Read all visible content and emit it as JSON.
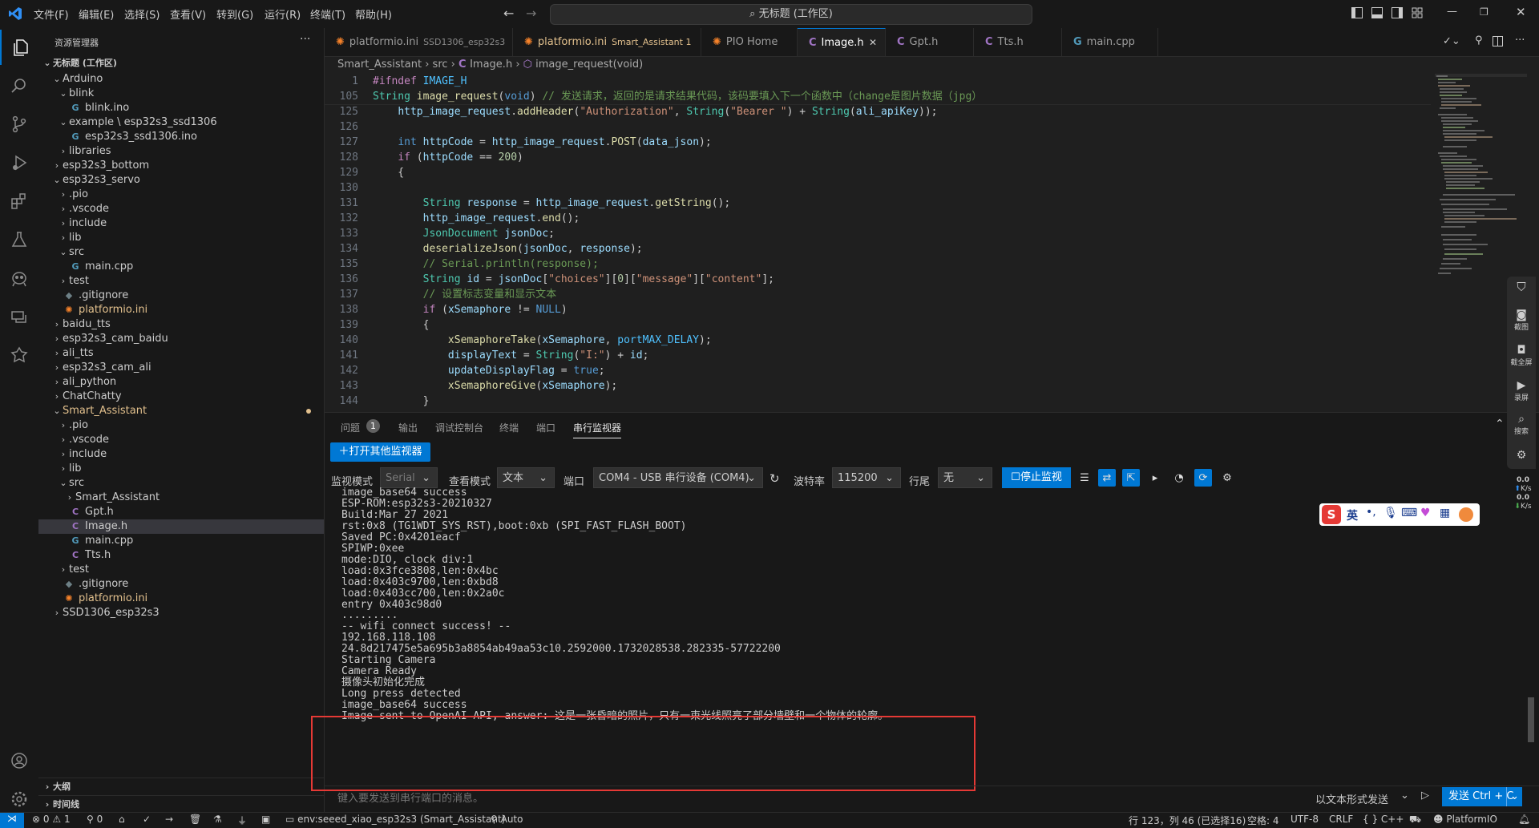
{
  "menu": [
    "文件(F)",
    "编辑(E)",
    "选择(S)",
    "查看(V)",
    "转到(G)",
    "运行(R)",
    "终端(T)",
    "帮助(H)"
  ],
  "command_center": "无标题 (工作区)",
  "sidebar": {
    "title": "资源管理器",
    "workspace": "无标题 (工作区)",
    "tree": [
      {
        "label": "Arduino",
        "depth": 1,
        "kind": "folder-open"
      },
      {
        "label": "blink",
        "depth": 2,
        "kind": "folder-open"
      },
      {
        "label": "blink.ino",
        "depth": 3,
        "kind": "ino"
      },
      {
        "label": "example \\ esp32s3_ssd1306",
        "depth": 2,
        "kind": "folder-open"
      },
      {
        "label": "esp32s3_ssd1306.ino",
        "depth": 3,
        "kind": "ino"
      },
      {
        "label": "libraries",
        "depth": 2,
        "kind": "folder"
      },
      {
        "label": "esp32s3_bottom",
        "depth": 1,
        "kind": "folder"
      },
      {
        "label": "esp32s3_servo",
        "depth": 1,
        "kind": "folder-open"
      },
      {
        "label": ".pio",
        "depth": 2,
        "kind": "folder"
      },
      {
        "label": ".vscode",
        "depth": 2,
        "kind": "folder"
      },
      {
        "label": "include",
        "depth": 2,
        "kind": "folder"
      },
      {
        "label": "lib",
        "depth": 2,
        "kind": "folder"
      },
      {
        "label": "src",
        "depth": 2,
        "kind": "folder-open"
      },
      {
        "label": "main.cpp",
        "depth": 3,
        "kind": "cpp"
      },
      {
        "label": "test",
        "depth": 2,
        "kind": "folder"
      },
      {
        "label": ".gitignore",
        "depth": 2,
        "kind": "git"
      },
      {
        "label": "platformio.ini",
        "depth": 2,
        "kind": "pio"
      },
      {
        "label": "baidu_tts",
        "depth": 1,
        "kind": "folder"
      },
      {
        "label": "esp32s3_cam_baidu",
        "depth": 1,
        "kind": "folder"
      },
      {
        "label": "ali_tts",
        "depth": 1,
        "kind": "folder"
      },
      {
        "label": "esp32s3_cam_ali",
        "depth": 1,
        "kind": "folder"
      },
      {
        "label": "ali_python",
        "depth": 1,
        "kind": "folder"
      },
      {
        "label": "ChatChatty",
        "depth": 1,
        "kind": "folder"
      },
      {
        "label": "Smart_Assistant",
        "depth": 1,
        "kind": "folder-open",
        "modified": true
      },
      {
        "label": ".pio",
        "depth": 2,
        "kind": "folder"
      },
      {
        "label": ".vscode",
        "depth": 2,
        "kind": "folder"
      },
      {
        "label": "include",
        "depth": 2,
        "kind": "folder"
      },
      {
        "label": "lib",
        "depth": 2,
        "kind": "folder"
      },
      {
        "label": "src",
        "depth": 2,
        "kind": "folder-open"
      },
      {
        "label": "Smart_Assistant",
        "depth": 3,
        "kind": "folder"
      },
      {
        "label": "Gpt.h",
        "depth": 3,
        "kind": "h"
      },
      {
        "label": "Image.h",
        "depth": 3,
        "kind": "h",
        "selected": true
      },
      {
        "label": "main.cpp",
        "depth": 3,
        "kind": "cpp"
      },
      {
        "label": "Tts.h",
        "depth": 3,
        "kind": "h"
      },
      {
        "label": "test",
        "depth": 2,
        "kind": "folder"
      },
      {
        "label": ".gitignore",
        "depth": 2,
        "kind": "git"
      },
      {
        "label": "platformio.ini",
        "depth": 2,
        "kind": "pio",
        "modified": true
      },
      {
        "label": "SSD1306_esp32s3",
        "depth": 1,
        "kind": "folder"
      }
    ],
    "outline": "大纲",
    "timeline": "时间线"
  },
  "tabs": [
    {
      "label": "platformio.ini",
      "sub": "SSD1306_esp32s3",
      "icon": "pio"
    },
    {
      "label": "platformio.ini",
      "sub": "Smart_Assistant 1",
      "icon": "pio",
      "modified": true
    },
    {
      "label": "PIO Home",
      "sub": "",
      "icon": "pio"
    },
    {
      "label": "Image.h",
      "sub": "",
      "icon": "h",
      "active": true
    },
    {
      "label": "Gpt.h",
      "sub": "",
      "icon": "h"
    },
    {
      "label": "Tts.h",
      "sub": "",
      "icon": "h"
    },
    {
      "label": "main.cpp",
      "sub": "",
      "icon": "cpp"
    }
  ],
  "breadcrumb": [
    "Smart_Assistant",
    "src",
    "Image.h",
    "image_request(void)"
  ],
  "code": [
    {
      "n": "1",
      "t": [
        [
          "pp",
          "#ifndef "
        ],
        [
          "cn",
          "IMAGE_H"
        ]
      ]
    },
    {
      "n": "105",
      "t": [
        [
          "ty",
          "String "
        ],
        [
          "fn",
          "image_request"
        ],
        [
          "",
          "("
        ],
        [
          "kw",
          "void"
        ],
        [
          "",
          ") "
        ],
        [
          "cm",
          "// 发送请求，返回的是请求结果代码，该码要填入下一个函数中（change是图片数据（jpg）"
        ]
      ]
    },
    {
      "n": "125",
      "t": [
        [
          "",
          "    "
        ],
        [
          "vr",
          "http_image_request"
        ],
        [
          "",
          "."
        ],
        [
          "fn",
          "addHeader"
        ],
        [
          "",
          "("
        ],
        [
          "st",
          "\"Authorization\""
        ],
        [
          "",
          ", "
        ],
        [
          "ty",
          "String"
        ],
        [
          "",
          "("
        ],
        [
          "st",
          "\"Bearer \""
        ],
        [
          "",
          ") + "
        ],
        [
          "ty",
          "String"
        ],
        [
          "",
          "("
        ],
        [
          "vr",
          "ali_apiKey"
        ],
        [
          "",
          "));"
        ]
      ]
    },
    {
      "n": "126",
      "t": []
    },
    {
      "n": "127",
      "t": [
        [
          "",
          "    "
        ],
        [
          "kw",
          "int "
        ],
        [
          "vr",
          "httpCode"
        ],
        [
          "",
          " = "
        ],
        [
          "vr",
          "http_image_request"
        ],
        [
          "",
          "."
        ],
        [
          "fn",
          "POST"
        ],
        [
          "",
          "("
        ],
        [
          "vr",
          "data_json"
        ],
        [
          "",
          ");"
        ]
      ]
    },
    {
      "n": "128",
      "t": [
        [
          "",
          "    "
        ],
        [
          "pp",
          "if "
        ],
        [
          "",
          "("
        ],
        [
          "vr",
          "httpCode"
        ],
        [
          "",
          " == "
        ],
        [
          "nm",
          "200"
        ],
        [
          "",
          ")"
        ]
      ]
    },
    {
      "n": "129",
      "t": [
        [
          "",
          "    {"
        ]
      ]
    },
    {
      "n": "130",
      "t": []
    },
    {
      "n": "131",
      "t": [
        [
          "",
          "        "
        ],
        [
          "ty",
          "String "
        ],
        [
          "vr",
          "response"
        ],
        [
          "",
          " = "
        ],
        [
          "vr",
          "http_image_request"
        ],
        [
          "",
          "."
        ],
        [
          "fn",
          "getString"
        ],
        [
          "",
          "();"
        ]
      ]
    },
    {
      "n": "132",
      "t": [
        [
          "",
          "        "
        ],
        [
          "vr",
          "http_image_request"
        ],
        [
          "",
          "."
        ],
        [
          "fn",
          "end"
        ],
        [
          "",
          "();"
        ]
      ]
    },
    {
      "n": "133",
      "t": [
        [
          "",
          "        "
        ],
        [
          "ty",
          "JsonDocument "
        ],
        [
          "vr",
          "jsonDoc"
        ],
        [
          "",
          ";"
        ]
      ]
    },
    {
      "n": "134",
      "t": [
        [
          "",
          "        "
        ],
        [
          "fn",
          "deserializeJson"
        ],
        [
          "",
          "("
        ],
        [
          "vr",
          "jsonDoc"
        ],
        [
          "",
          ", "
        ],
        [
          "vr",
          "response"
        ],
        [
          "",
          ");"
        ]
      ]
    },
    {
      "n": "135",
      "t": [
        [
          "",
          "        "
        ],
        [
          "cm",
          "// Serial.println(response);"
        ]
      ]
    },
    {
      "n": "136",
      "t": [
        [
          "",
          "        "
        ],
        [
          "ty",
          "String "
        ],
        [
          "vr",
          "id"
        ],
        [
          "",
          " = "
        ],
        [
          "vr",
          "jsonDoc"
        ],
        [
          "",
          "["
        ],
        [
          "st",
          "\"choices\""
        ],
        [
          "",
          "]["
        ],
        [
          "nm",
          "0"
        ],
        [
          "",
          "]["
        ],
        [
          "st",
          "\"message\""
        ],
        [
          "",
          "]["
        ],
        [
          "st",
          "\"content\""
        ],
        [
          "",
          "];"
        ]
      ]
    },
    {
      "n": "137",
      "t": [
        [
          "",
          "        "
        ],
        [
          "cm",
          "// 设置标志变量和显示文本"
        ]
      ]
    },
    {
      "n": "138",
      "t": [
        [
          "",
          "        "
        ],
        [
          "pp",
          "if "
        ],
        [
          "",
          "("
        ],
        [
          "vr",
          "xSemaphore"
        ],
        [
          "",
          " != "
        ],
        [
          "kw",
          "NULL"
        ],
        [
          "",
          ")"
        ]
      ]
    },
    {
      "n": "139",
      "t": [
        [
          "",
          "        {"
        ]
      ]
    },
    {
      "n": "140",
      "t": [
        [
          "",
          "            "
        ],
        [
          "fn",
          "xSemaphoreTake"
        ],
        [
          "",
          "("
        ],
        [
          "vr",
          "xSemaphore"
        ],
        [
          "",
          ", "
        ],
        [
          "cn",
          "portMAX_DELAY"
        ],
        [
          "",
          ");"
        ]
      ]
    },
    {
      "n": "141",
      "t": [
        [
          "",
          "            "
        ],
        [
          "vr",
          "displayText"
        ],
        [
          "",
          " = "
        ],
        [
          "ty",
          "String"
        ],
        [
          "",
          "("
        ],
        [
          "st",
          "\"I:\""
        ],
        [
          "",
          ") + "
        ],
        [
          "vr",
          "id"
        ],
        [
          "",
          ";"
        ]
      ]
    },
    {
      "n": "142",
      "t": [
        [
          "",
          "            "
        ],
        [
          "vr",
          "updateDisplayFlag"
        ],
        [
          "",
          " = "
        ],
        [
          "kw",
          "true"
        ],
        [
          "",
          ";"
        ]
      ]
    },
    {
      "n": "143",
      "t": [
        [
          "",
          "            "
        ],
        [
          "fn",
          "xSemaphoreGive"
        ],
        [
          "",
          "("
        ],
        [
          "vr",
          "xSemaphore"
        ],
        [
          "",
          ");"
        ]
      ]
    },
    {
      "n": "144",
      "t": [
        [
          "",
          "        }"
        ]
      ]
    }
  ],
  "panel": {
    "tabs": [
      "问题",
      "输出",
      "调试控制台",
      "终端",
      "端口",
      "串行监视器"
    ],
    "problems_count": "1",
    "open_monitor": "打开其他监视器",
    "monitor_mode_label": "监视模式",
    "monitor_mode": "Serial",
    "view_mode_label": "查看模式",
    "view_mode": "文本",
    "port_label": "端口",
    "port": "COM4 - USB 串行设备 (COM4)",
    "baud_label": "波特率",
    "baud": "115200",
    "line_end_label": "行尾",
    "line_end": "无",
    "stop": "停止监视",
    "output": [
      "image_base64 success",
      "ESP-ROM:esp32s3-20210327",
      "Build:Mar 27 2021",
      "rst:0x8 (TG1WDT_SYS_RST),boot:0xb (SPI_FAST_FLASH_BOOT)",
      "Saved PC:0x4201eacf",
      "SPIWP:0xee",
      "mode:DIO, clock div:1",
      "load:0x3fce3808,len:0x4bc",
      "load:0x403c9700,len:0xbd8",
      "load:0x403cc700,len:0x2a0c",
      "entry 0x403c98d0",
      ".........",
      "-- wifi connect success! --",
      "192.168.118.108",
      "24.8d217475e5a695b3a8854ab49aa53c10.2592000.1732028538.282335-57722200",
      "Starting Camera",
      "Camera Ready",
      "摄像头初始化完成",
      "Long press detected",
      "image_base64 success",
      "Image sent to OpenAI API, answer: 这是一张昏暗的照片，只有一束光线照亮了部分墙壁和一个物体的轮廓。"
    ],
    "input_placeholder": "键入要发送到串行端口的消息。",
    "send_mode": "以文本形式发送",
    "send_button": "发送 Ctrl + C"
  },
  "statusbar": {
    "errors": "0",
    "warnings": "1",
    "ports": "0",
    "env": "env:seeed_xiao_esp32s3 (Smart_Assistant)",
    "auto": "Auto",
    "position": "行 123，列 46 (已选择16)",
    "spaces": "空格: 4",
    "encoding": "UTF-8",
    "eol": "CRLF",
    "language": "C++",
    "platformio": "PlatformIO"
  },
  "floattool": [
    "截图",
    "截全屏",
    "录屏",
    "搜索"
  ],
  "netspeed": [
    "0.0",
    "K/s",
    "0.0",
    "K/s"
  ],
  "ime": "英",
  "colors": {
    "accent": "#0078d4",
    "highlight_box": "#e53935",
    "modified": "#e2c08d",
    "pio": "#f5822a",
    "header_icon": "#a074c4",
    "cpp_icon": "#519aba"
  }
}
